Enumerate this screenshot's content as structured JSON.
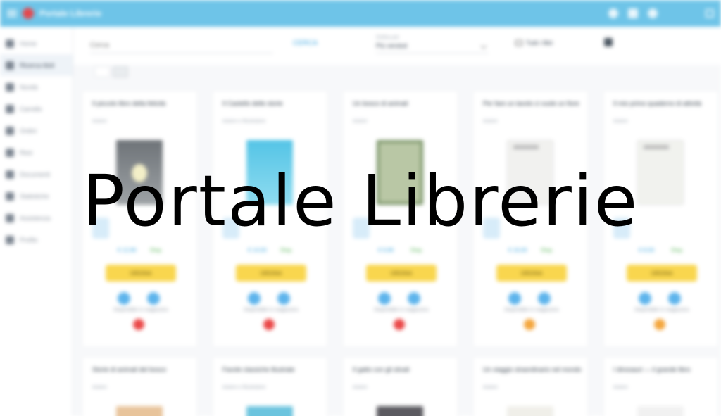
{
  "app": {
    "title": "Portale Librerie"
  },
  "topbar": {
    "icons": [
      "menu-icon",
      "user-icon",
      "notifications-icon",
      "settings-icon",
      "apps-icon"
    ]
  },
  "sidebar": {
    "items": [
      {
        "label": "Home",
        "icon": "home-icon"
      },
      {
        "label": "Ricerca titoli",
        "icon": "book-icon",
        "active": true
      },
      {
        "label": "Novità",
        "icon": "star-icon"
      },
      {
        "label": "Carrello",
        "icon": "cart-icon"
      },
      {
        "label": "Ordini",
        "icon": "list-icon"
      },
      {
        "label": "Resi",
        "icon": "return-icon"
      },
      {
        "label": "Documenti",
        "icon": "doc-icon"
      },
      {
        "label": "Statistiche",
        "icon": "chart-icon"
      },
      {
        "label": "Assistenza",
        "icon": "help-icon"
      },
      {
        "label": "Profilo",
        "icon": "profile-icon"
      }
    ]
  },
  "toolbar": {
    "search_placeholder": "Cerca",
    "search_button": "CERCA",
    "sort_label": "Ordina per",
    "sort_value": "Più venduti",
    "filter_label": "Tutti i filtri",
    "cart_icon": "cart-icon"
  },
  "products": [
    {
      "title": "Il piccolo libro della felicità",
      "author": "Autore",
      "price": "€ 12,90",
      "availability": "Disp.",
      "order": "ORDINA",
      "note": "Disponibile in magazzino",
      "status": "red"
    },
    {
      "title": "Il Castello delle storie",
      "author": "Autore e Illustratore",
      "price": "€ 14,50",
      "availability": "Disp.",
      "order": "ORDINA",
      "note": "Disponibile in magazzino",
      "status": "red"
    },
    {
      "title": "Un bosco di animali",
      "author": "Autore",
      "price": "€ 9,90",
      "availability": "Disp.",
      "order": "ORDINA",
      "note": "Disponibile in magazzino",
      "status": "red"
    },
    {
      "title": "Per fare un tavolo ci vuole un fiore",
      "author": "Autore",
      "price": "€ 16,00",
      "availability": "Disp.",
      "order": "ORDINA",
      "note": "Disponibile in magazzino",
      "status": "orange"
    },
    {
      "title": "Il mio primo quaderno di attività",
      "author": "Autore",
      "price": "€ 8,50",
      "availability": "Disp.",
      "order": "ORDINA",
      "note": "Disponibile in magazzino",
      "status": "orange"
    }
  ],
  "products_row2": [
    {
      "title": "Storie di animali del bosco",
      "author": "Autore"
    },
    {
      "title": "Favole classiche illustrate",
      "author": "Autore e Illustratore"
    },
    {
      "title": "Il gatto con gli stivali",
      "author": "Autore"
    },
    {
      "title": "Un viaggio straordinario nel mondo",
      "author": "Autore"
    },
    {
      "title": "I dinosauri — il grande libro",
      "author": "Autore"
    }
  ]
}
